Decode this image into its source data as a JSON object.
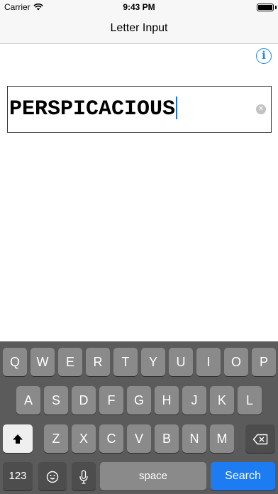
{
  "status_bar": {
    "carrier": "Carrier",
    "time": "9:43 PM",
    "icons": [
      "wifi-icon",
      "battery-icon"
    ]
  },
  "nav_bar": {
    "title": "Letter Input"
  },
  "info_button": {
    "glyph": "i",
    "icon": "info-icon",
    "color": "#1e88e5"
  },
  "text_field": {
    "value": "PERSPICACIOUS",
    "clear_icon": "clear-icon"
  },
  "keyboard": {
    "row1": [
      "Q",
      "W",
      "E",
      "R",
      "T",
      "Y",
      "U",
      "I",
      "O",
      "P"
    ],
    "row2": [
      "A",
      "S",
      "D",
      "F",
      "G",
      "H",
      "J",
      "K",
      "L"
    ],
    "row3": [
      "Z",
      "X",
      "C",
      "V",
      "B",
      "N",
      "M"
    ],
    "numbers_label": "123",
    "space_label": "space",
    "return_label": "Search",
    "icons": {
      "shift": "shift-icon",
      "delete": "delete-icon",
      "emoji": "emoji-icon",
      "microphone": "microphone-icon"
    },
    "return_color": "#1d7cf2"
  }
}
